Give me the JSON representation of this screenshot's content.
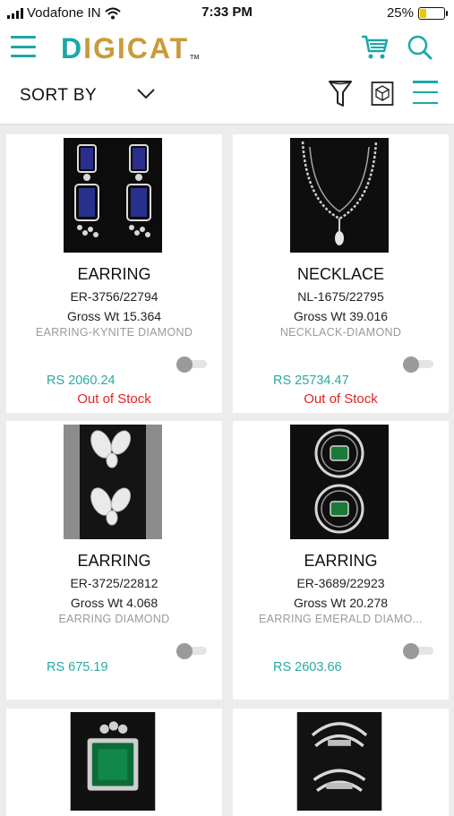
{
  "status_bar": {
    "carrier": "Vodafone IN",
    "time": "7:33 PM",
    "battery": "25%",
    "battery_level": 0.25,
    "icons": [
      "signal-icon",
      "wifi-icon",
      "battery-icon"
    ]
  },
  "header": {
    "logo_d": "D",
    "logo_rest": "IGICAT",
    "logo_tm": "TM",
    "icons": [
      "menu-icon",
      "cart-icon",
      "search-icon"
    ],
    "accent": "#1aa8a8",
    "brand_gold": "#c99a3a"
  },
  "sortbar": {
    "label": "SORT BY",
    "icons": [
      "chevron-down-icon",
      "filter-icon",
      "box-icon",
      "list-view-icon"
    ]
  },
  "products": [
    {
      "type": "EARRING",
      "code": "ER-3756/22794",
      "gross": "Gross Wt  15.364",
      "desc": "EARRING-KYNITE DIAMOND",
      "price": "RS 2060.24",
      "stock": "Out of Stock",
      "image": "earring-blue-drop"
    },
    {
      "type": "NECKLACE",
      "code": "NL-1675/22795",
      "gross": "Gross Wt  39.016",
      "desc": "NECKLACK-DIAMOND",
      "price": "RS 25734.47",
      "stock": "Out of Stock",
      "image": "necklace-diamond"
    },
    {
      "type": "EARRING",
      "code": "ER-3725/22812",
      "gross": "Gross Wt  4.068",
      "desc": "EARRING DIAMOND",
      "price": "RS 675.19",
      "stock": "",
      "image": "earring-petal"
    },
    {
      "type": "EARRING",
      "code": "ER-3689/22923",
      "gross": "Gross Wt  20.278",
      "desc": "EARRING EMERALD DIAMO...",
      "price": "RS 2603.66",
      "stock": "",
      "image": "earring-emerald-hoop"
    },
    {
      "type": "",
      "code": "",
      "gross": "",
      "desc": "",
      "price": "",
      "stock": "",
      "image": "ring-emerald"
    },
    {
      "type": "",
      "code": "",
      "gross": "",
      "desc": "",
      "price": "",
      "stock": "",
      "image": "ring-diamond-band"
    }
  ],
  "colors": {
    "price": "#2aa9a3",
    "out_of_stock": "#e42222"
  }
}
